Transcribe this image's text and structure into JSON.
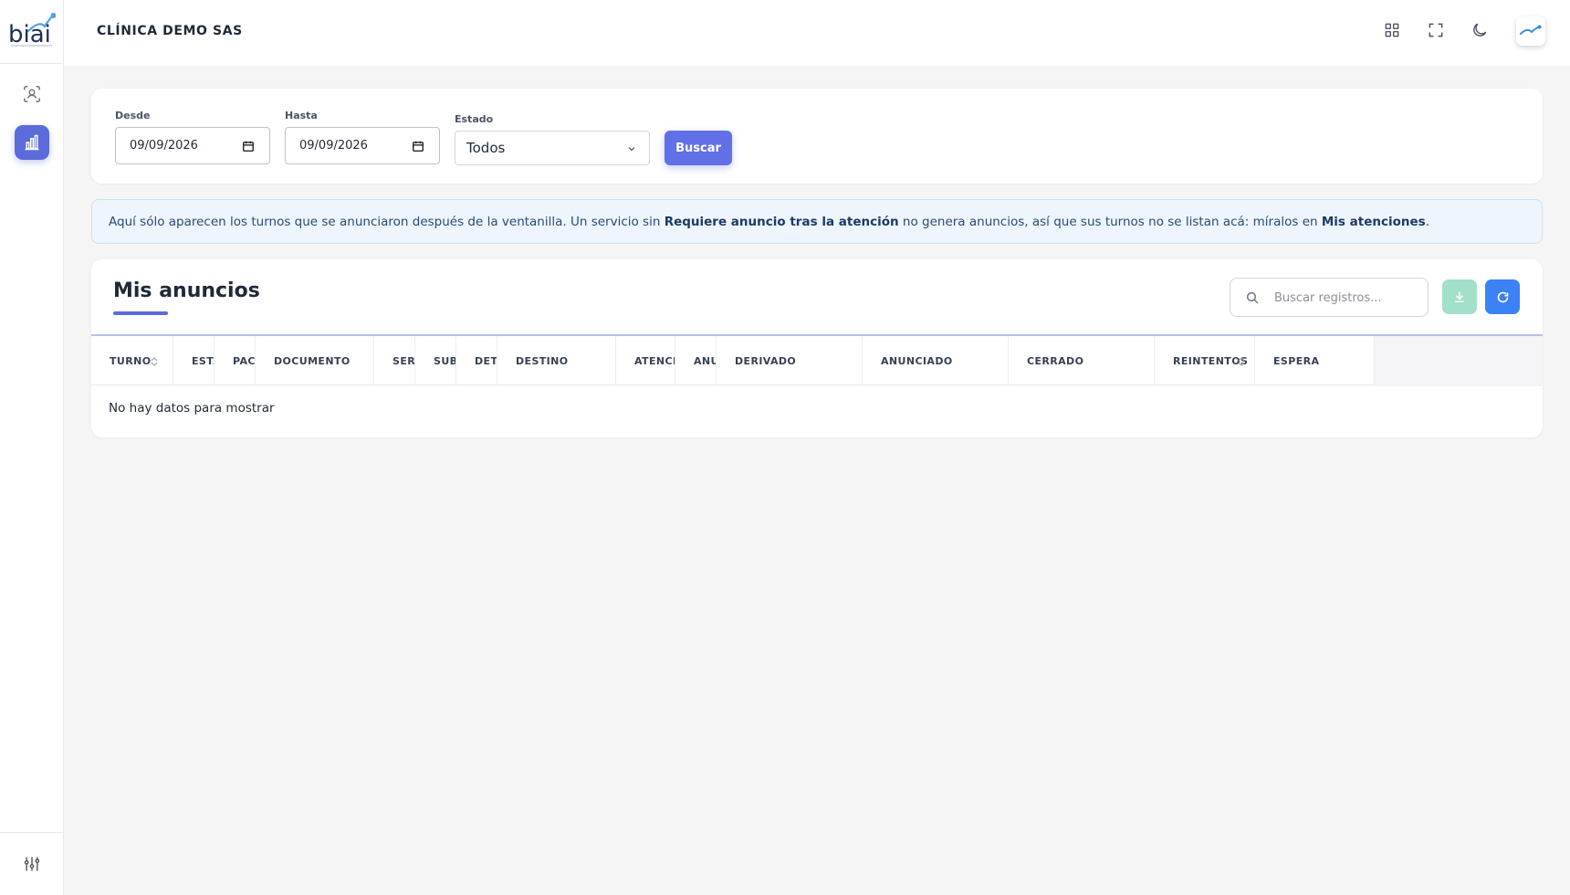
{
  "sidebar": {
    "logo_text": "biai",
    "items": [
      {
        "name": "user-scan",
        "icon": "user-scan-icon",
        "active": false
      },
      {
        "name": "reports",
        "icon": "bar-chart-icon",
        "active": true
      }
    ],
    "bottom_icon": "sliders-icon"
  },
  "header": {
    "company": "CLÍNICA DEMO SAS",
    "icons": [
      "grid-icon",
      "fullscreen-icon",
      "moon-icon",
      "avatar-logo-icon"
    ]
  },
  "filters": {
    "desde_label": "Desde",
    "desde_value": "09/09/2026",
    "hasta_label": "Hasta",
    "hasta_value": "09/09/2026",
    "estado_label": "Estado",
    "estado_value": "Todos",
    "buscar_label": "Buscar"
  },
  "info": {
    "part1": "Aquí sólo aparecen los turnos que se anunciaron después de la ventanilla. Un servicio sin ",
    "bold1": "Requiere anuncio tras la atención",
    "part2": " no genera anuncios, así que sus turnos no se listan acá: míralos en ",
    "bold2": "Mis atenciones",
    "part3": "."
  },
  "table": {
    "title": "Mis anuncios",
    "search_placeholder": "Buscar registros...",
    "columns": [
      "TURNO",
      "ESTADO",
      "PACIENTE",
      "DOCUMENTO",
      "SERVICIO",
      "SUB",
      "DETALLE",
      "DESTINO",
      "ATENCIÓN",
      "ANUNCIO",
      "DERIVADO",
      "ANUNCIADO",
      "CERRADO",
      "REINTENTOS",
      "ESPERA"
    ],
    "empty_text": "No hay datos para mostrar"
  },
  "colors": {
    "primary": "#5b6bdc",
    "buscar": "#6270e8",
    "download": "#a3e0c9",
    "refresh": "#3b82f6",
    "info_bg": "#eef5fd"
  }
}
